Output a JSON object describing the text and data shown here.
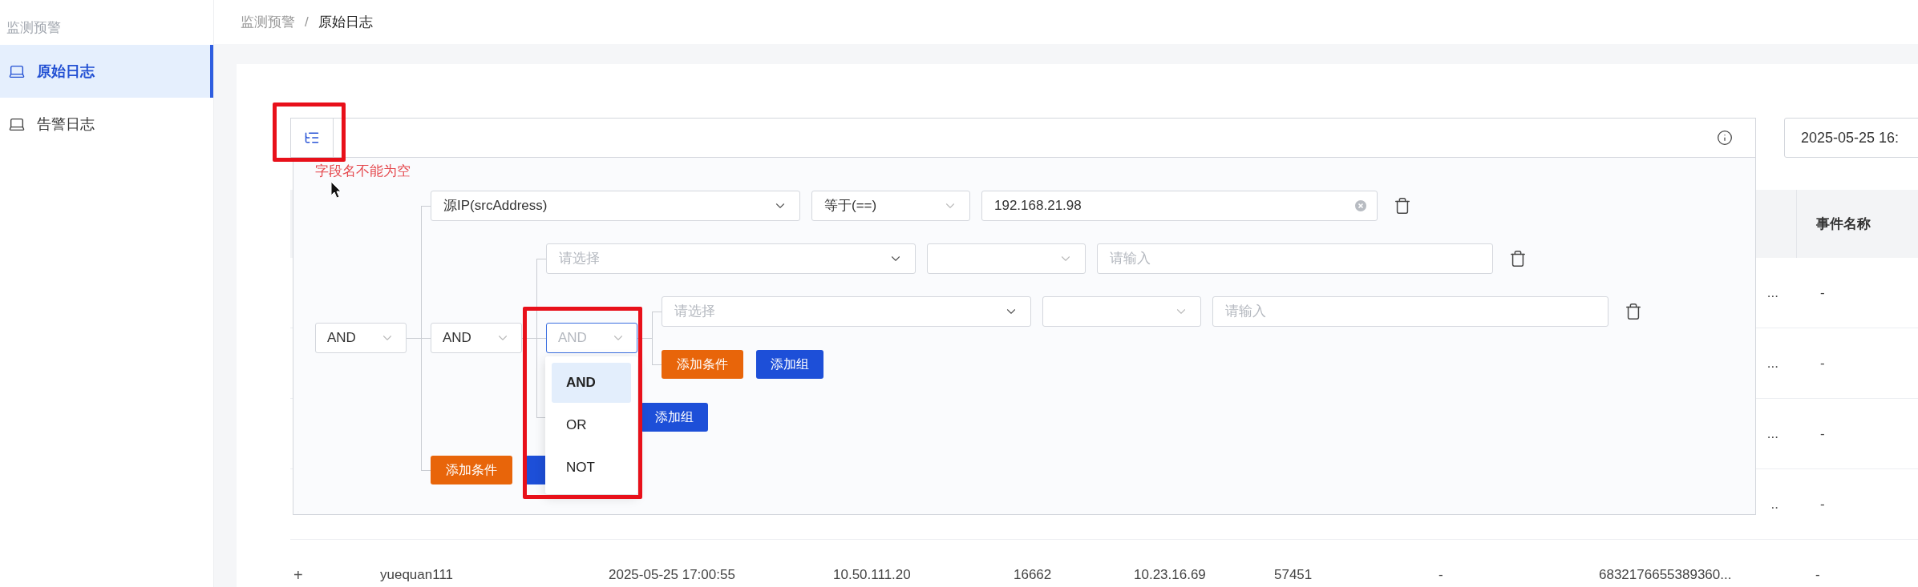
{
  "sidebar": {
    "section": "监测预警",
    "items": [
      {
        "label": "原始日志",
        "selected": true
      },
      {
        "label": "告警日志",
        "selected": false
      }
    ]
  },
  "breadcrumb": {
    "separator": "/",
    "items": [
      {
        "label": "监测预警",
        "current": false
      },
      {
        "label": "原始日志",
        "current": true
      }
    ]
  },
  "query_bar": {
    "error": "字段名不能为空"
  },
  "date_range": {
    "value": "2025-05-25 16:"
  },
  "builder": {
    "logic": "AND",
    "open": false,
    "children": [
      {
        "kind": "condition",
        "field": {
          "value": "源IP(srcAddress)"
        },
        "operator": {
          "value": "等于(==)"
        },
        "input": {
          "value": "192.168.21.98"
        }
      },
      {
        "kind": "group",
        "logic": "AND",
        "open": false,
        "children": [
          {
            "kind": "condition",
            "field": {
              "placeholder": "请选择"
            },
            "input": {
              "placeholder": "请输入"
            }
          },
          {
            "kind": "group",
            "logic": "AND",
            "open": true,
            "menu": [
              {
                "label": "AND",
                "selected": true
              },
              {
                "label": "OR",
                "selected": false
              },
              {
                "label": "NOT",
                "selected": false
              }
            ],
            "children": [
              {
                "kind": "condition",
                "field": {
                  "placeholder": "请选择"
                },
                "input": {
                  "placeholder": "请输入"
                }
              }
            ],
            "actions": [
              {
                "kind": "condition",
                "label": "添加条件"
              },
              {
                "kind": "group",
                "label": "添加组"
              }
            ]
          }
        ],
        "actions": [
          {
            "kind": "condition",
            "covered": true
          },
          {
            "kind": "group",
            "label": "添加组"
          }
        ]
      }
    ],
    "actions": [
      {
        "kind": "condition",
        "label": "添加条件"
      },
      {
        "kind": "group",
        "covered": true
      }
    ]
  },
  "table": {
    "event_name_header": "事件名称",
    "rows": [
      {
        "kind": "partial",
        "id_tail": "...",
        "event_name": "-"
      },
      {
        "kind": "partial",
        "id_tail": "...",
        "event_name": "-"
      },
      {
        "kind": "partial",
        "id_tail": "...",
        "event_name": "-"
      },
      {
        "kind": "partial",
        "id_tail": "..",
        "event_name": "-"
      },
      {
        "kind": "full",
        "expand": "+",
        "cells": [
          "yuequan111",
          "2025-05-25 17:00:55",
          "10.50.111.20",
          "16662",
          "10.23.16.69",
          "57451",
          "-",
          "6832176655389360...",
          "-"
        ]
      }
    ]
  }
}
